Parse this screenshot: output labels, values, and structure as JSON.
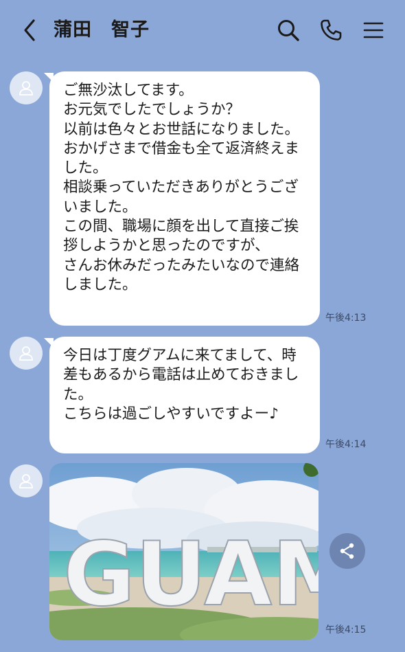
{
  "header": {
    "title": "蒲田　智子",
    "back_icon": "chevron-left-icon",
    "search_icon": "search-icon",
    "call_icon": "phone-icon",
    "menu_icon": "hamburger-menu-icon"
  },
  "messages": [
    {
      "text": "ご無沙汰してます。\nお元気でしたでしょうか？\n以前は色々とお世話になりました。\nおかげさまで借金も全て返済終えました。\n相談乗っていただきありがとうございました。\nこの間、職場に顔を出して直接ご挨拶しようかと思ったのですが、　　　さんお休みだったみたいなので連絡しました。",
      "time": "午後4:13"
    },
    {
      "text": "今日は丁度グアムに来てまして、時差もあるから電話は止めておきました。\nこちらは過ごしやすいですよー♪",
      "time": "午後4:14"
    },
    {
      "image_text": "GUAM",
      "time": "午後4:15"
    }
  ],
  "colors": {
    "background": "#8ba7d7",
    "bubble": "#ffffff",
    "avatar": "#dfe7f5"
  }
}
